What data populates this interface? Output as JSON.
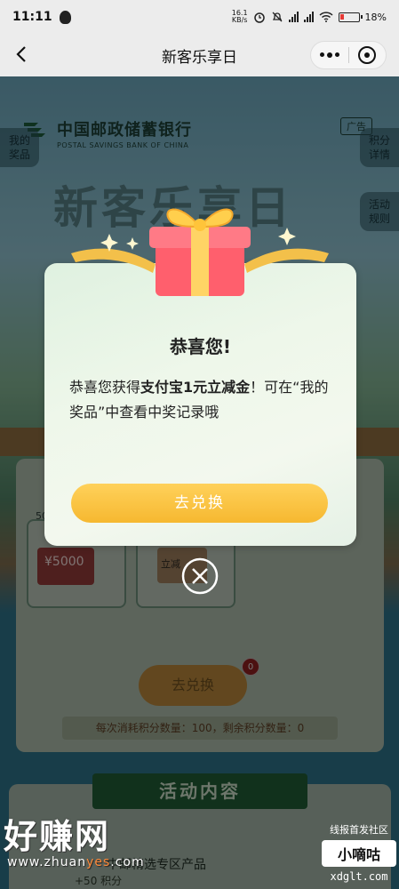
{
  "status_bar": {
    "time": "11:11",
    "speed_top": "16.1",
    "speed_bottom": "KB/s",
    "battery": "18%"
  },
  "nav": {
    "title": "新客乐享日"
  },
  "page": {
    "bank_name_cn": "中国邮政储蓄银行",
    "bank_name_en": "POSTAL SAVINGS BANK OF CHINA",
    "ad_label": "广告",
    "side_left": "我的\n奖品",
    "side_right_1": "积分\n详情",
    "side_right_2": "活动\n规则",
    "banner_title": "新客乐享日",
    "prize_1_label": "50",
    "prize_1_coupon": "5000",
    "prize_2_coupon": "立减",
    "redeem_button": "去兑换",
    "redeem_badge": "0",
    "consume_text": "每次消耗积分数量：100，剩余积分数量：0",
    "section_title": "活动内容",
    "task_text": "中邮精选专区产品",
    "task_points": "+50 积分"
  },
  "modal": {
    "title": "恭喜您!",
    "message_prefix": "恭喜您获得",
    "message_highlight": "支付宝1元立减金",
    "message_suffix": "！可在“我的奖品”中查看中奖记录哦",
    "button": "去兑换"
  },
  "watermark": {
    "left_big": "好赚网",
    "left_url_a": "www.zhuan",
    "left_url_b": "yes",
    "left_url_c": ".com",
    "right_top": "线报首发社区",
    "right_brand": "小嘀咕",
    "right_domain": "xdglt.com"
  },
  "colors": {
    "accent": "#f6b830",
    "modal_bg": "#eef7ea",
    "overlay": "rgba(0,0,0,0.45)"
  }
}
